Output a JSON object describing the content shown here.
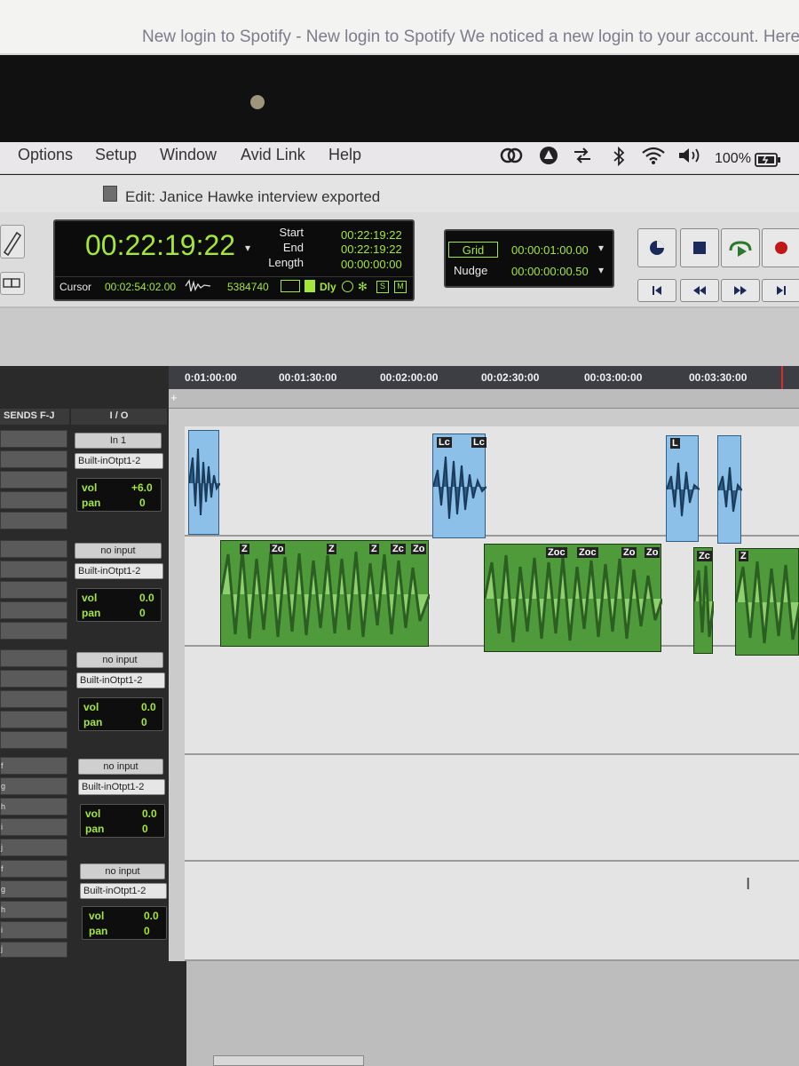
{
  "notification": {
    "text": "New login to Spotify - New login to Spotify We noticed a new login to your account. Here"
  },
  "menubar": {
    "items": [
      "Options",
      "Setup",
      "Window",
      "Avid Link",
      "Help"
    ],
    "battery": "100%"
  },
  "window": {
    "title": "Edit: Janice Hawke interview exported"
  },
  "counter": {
    "main": "00:22:19:22",
    "start_label": "Start",
    "start": "00:22:19:22",
    "end_label": "End",
    "end": "00:22:19:22",
    "length_label": "Length",
    "length": "00:00:00:00",
    "cursor_label": "Cursor",
    "cursor": "00:02:54:02.00",
    "samples": "5384740",
    "dly": "Dly",
    "s": "S",
    "m": "M"
  },
  "grid": {
    "grid_label": "Grid",
    "grid_value": "00:00:01:00.00",
    "nudge_label": "Nudge",
    "nudge_value": "00:00:00:00.50"
  },
  "ruler": {
    "ticks": [
      "0:01:00:00",
      "00:01:30:00",
      "00:02:00:00",
      "00:02:30:00",
      "00:03:00:00",
      "00:03:30:00"
    ]
  },
  "headers": {
    "sends": "SENDS F-J",
    "io": "I / O"
  },
  "tracks": [
    {
      "input": "In 1",
      "output": "Built-inOtpt1-2",
      "vol_label": "vol",
      "vol": "+6.0",
      "pan_label": "pan",
      "pan": "0"
    },
    {
      "input": "no input",
      "output": "Built-inOtpt1-2",
      "vol_label": "vol",
      "vol": "0.0",
      "pan_label": "pan",
      "pan": "0"
    },
    {
      "input": "no input",
      "output": "Built-inOtpt1-2",
      "vol_label": "vol",
      "vol": "0.0",
      "pan_label": "pan",
      "pan": "0"
    },
    {
      "input": "no input",
      "output": "Built-inOtpt1-2",
      "vol_label": "vol",
      "vol": "0.0",
      "pan_label": "pan",
      "pan": "0"
    },
    {
      "input": "no input",
      "output": "Built-inOtpt1-2",
      "vol_label": "vol",
      "vol": "0.0",
      "pan_label": "pan",
      "pan": "0"
    }
  ],
  "send_labels": {
    "f": "f",
    "g": "g",
    "h": "h",
    "i": "i",
    "j": "j"
  },
  "clip_tags": {
    "blue": [
      "Lc",
      "Lc",
      "L"
    ],
    "green": [
      "Z",
      "Zo",
      "Z",
      "Z",
      "Zc",
      "Zo",
      "Zoc",
      "Zoc",
      "Zo",
      "Zo",
      "Zc",
      "Z"
    ]
  },
  "colors": {
    "lcd_green": "#a4e836",
    "clip_blue": "#8cc0e8",
    "clip_green": "#4f9a3b"
  }
}
